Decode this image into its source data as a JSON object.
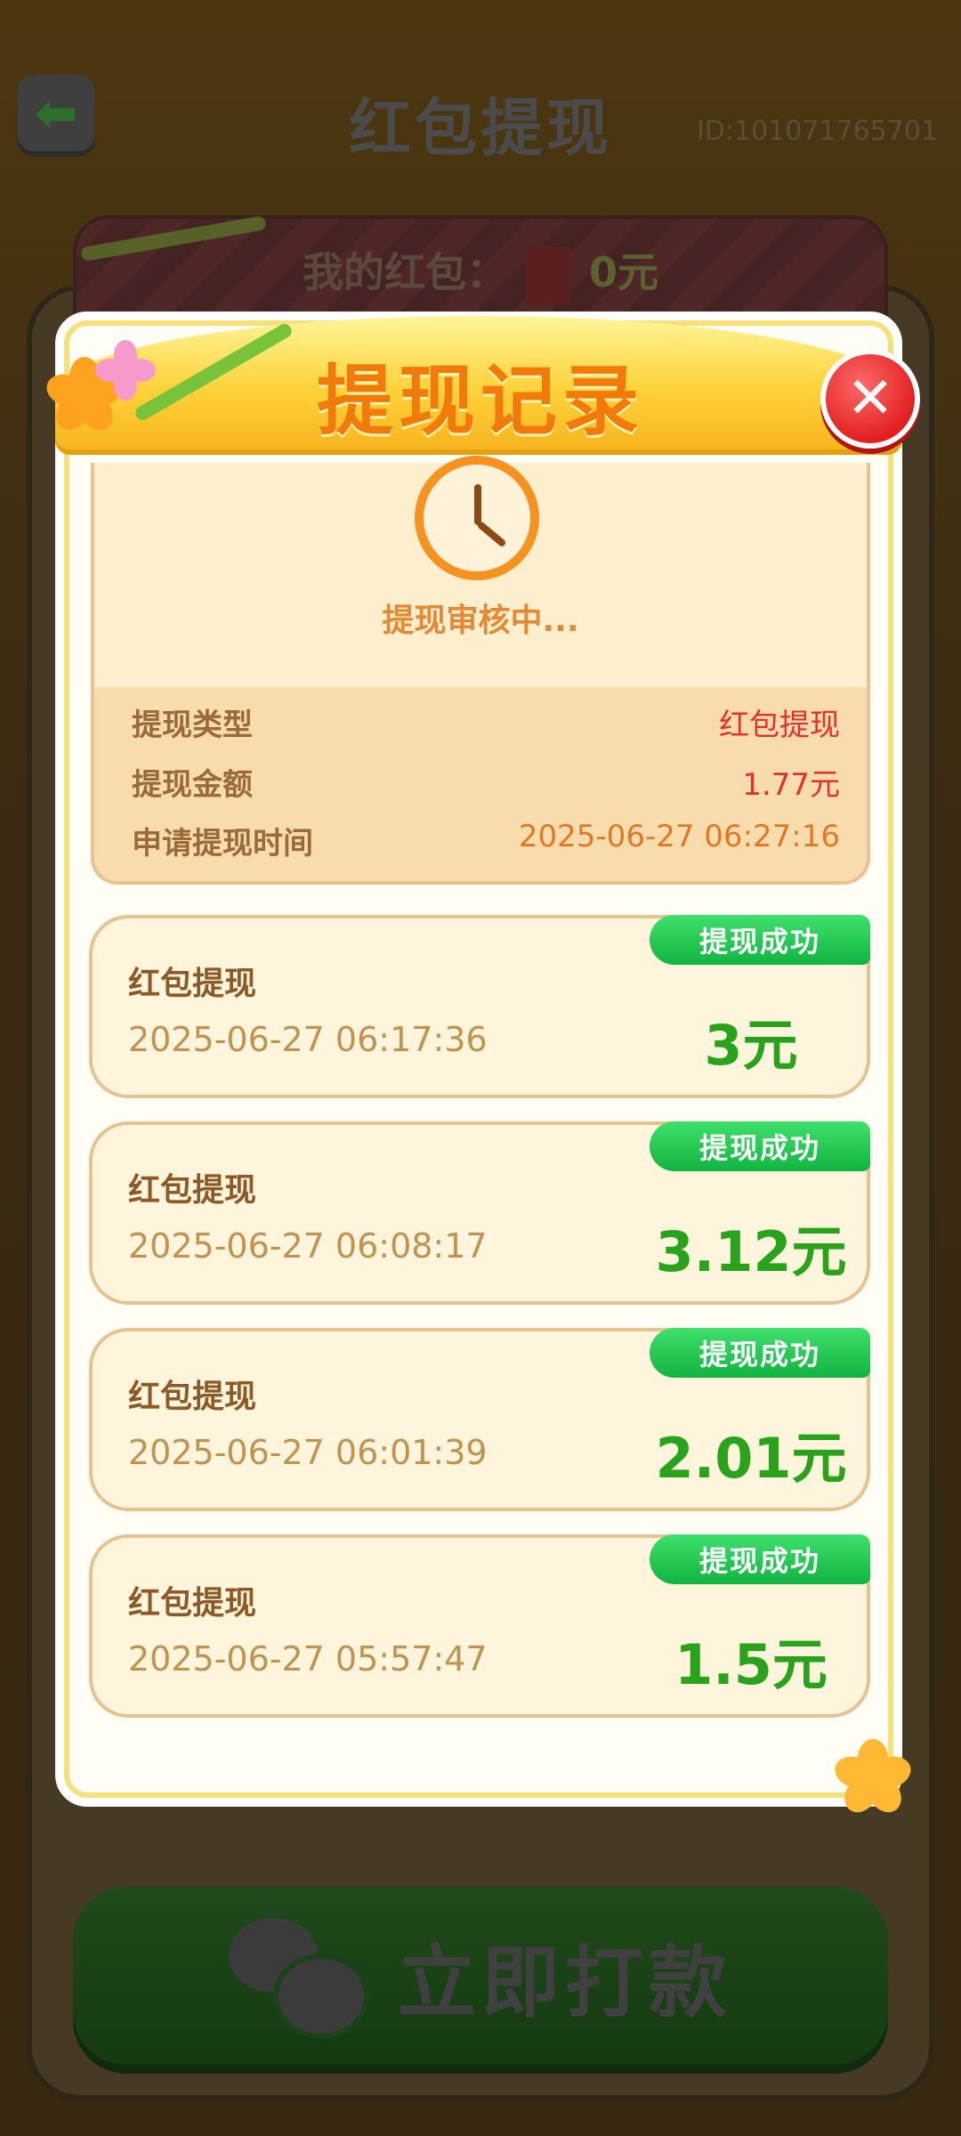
{
  "background": {
    "page_title": "红包提现",
    "user_id": "ID:101071765701",
    "my_redpack_label": "我的红包：",
    "my_redpack_amount": "0元",
    "pay_button_label": "立即打款"
  },
  "modal": {
    "title": "提现记录",
    "pending": {
      "status": "提现审核中...",
      "rows": [
        {
          "label": "提现类型",
          "value": "红包提现",
          "color": "#e5302b"
        },
        {
          "label": "提现金额",
          "value": "1.77元",
          "color": "#e5302b"
        },
        {
          "label": "申请提现时间",
          "value": "2025-06-27 06:27:16",
          "color": "#e07a22"
        }
      ]
    },
    "records": [
      {
        "type": "红包提现",
        "time": "2025-06-27 06:17:36",
        "amount": "3元",
        "status": "提现成功"
      },
      {
        "type": "红包提现",
        "time": "2025-06-27 06:08:17",
        "amount": "3.12元",
        "status": "提现成功"
      },
      {
        "type": "红包提现",
        "time": "2025-06-27 06:01:39",
        "amount": "2.01元",
        "status": "提现成功"
      },
      {
        "type": "红包提现",
        "time": "2025-06-27 05:57:47",
        "amount": "1.5元",
        "status": "提现成功"
      }
    ]
  }
}
